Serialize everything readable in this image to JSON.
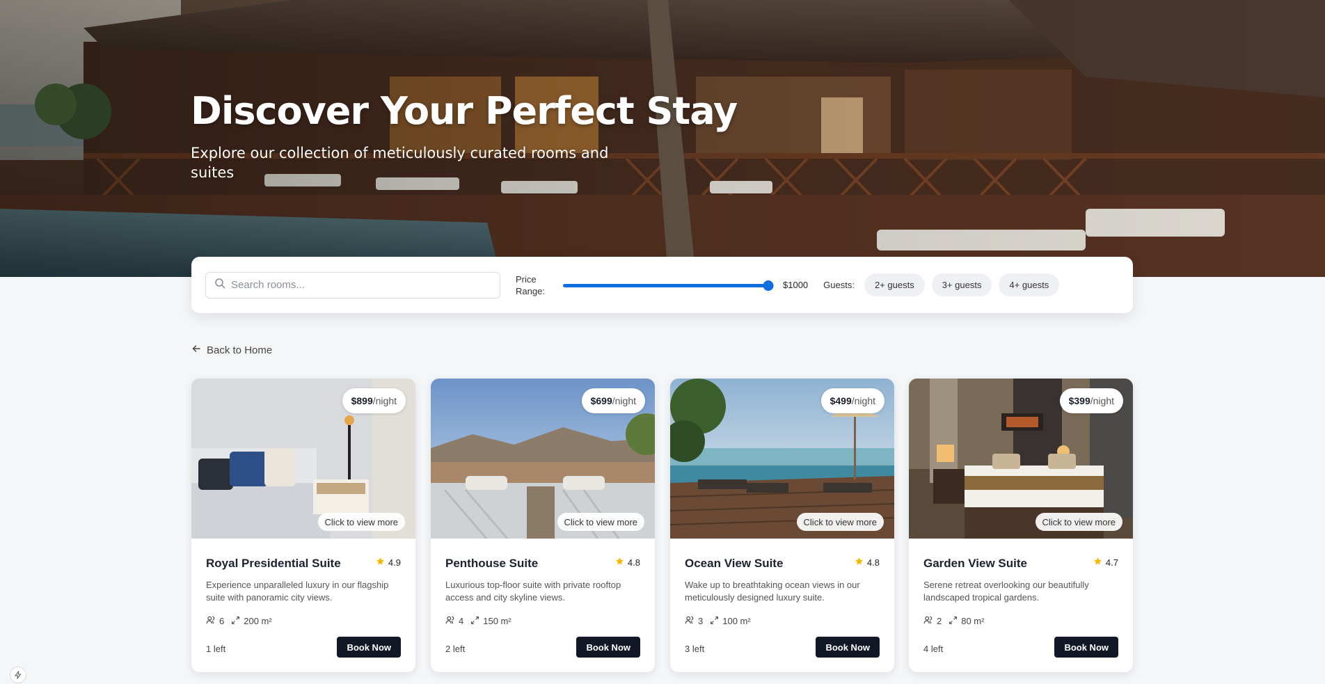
{
  "hero": {
    "title": "Discover Your Perfect Stay",
    "subtitle": "Explore our collection of meticulously curated rooms and suites"
  },
  "filters": {
    "search_placeholder": "Search rooms...",
    "search_value": "",
    "price_label": "Price Range:",
    "price_value": "$1000",
    "price_slider_fraction": 1.0,
    "guests_label": "Guests:",
    "guest_options": [
      "2+ guests",
      "3+ guests",
      "4+ guests"
    ]
  },
  "nav": {
    "back_label": "Back to Home"
  },
  "common": {
    "per_night": "/night",
    "view_more": "Click to view more",
    "book_label": "Book Now"
  },
  "rooms": [
    {
      "name": "Royal Presidential Suite",
      "price": "$899",
      "rating": "4.9",
      "description": "Experience unparalleled luxury in our flagship suite with panoramic city views.",
      "guests": "6",
      "size": "200 m²",
      "availability": "1 left"
    },
    {
      "name": "Penthouse Suite",
      "price": "$699",
      "rating": "4.8",
      "description": "Luxurious top-floor suite with private rooftop access and city skyline views.",
      "guests": "4",
      "size": "150 m²",
      "availability": "2 left"
    },
    {
      "name": "Ocean View Suite",
      "price": "$499",
      "rating": "4.8",
      "description": "Wake up to breathtaking ocean views in our meticulously designed luxury suite.",
      "guests": "3",
      "size": "100 m²",
      "availability": "3 left"
    },
    {
      "name": "Garden View Suite",
      "price": "$399",
      "rating": "4.7",
      "description": "Serene retreat overlooking our beautifully landscaped tropical gardens.",
      "guests": "2",
      "size": "80 m²",
      "availability": "4 left"
    }
  ],
  "colors": {
    "accent": "#0f6fe0",
    "button_dark": "#121826",
    "star": "#f5b700",
    "page_bg": "#f4f6f8"
  },
  "icons": {
    "search": "search-icon",
    "back": "arrow-left-icon",
    "rating": "star-icon",
    "guests": "users-icon",
    "size": "expand-icon"
  }
}
